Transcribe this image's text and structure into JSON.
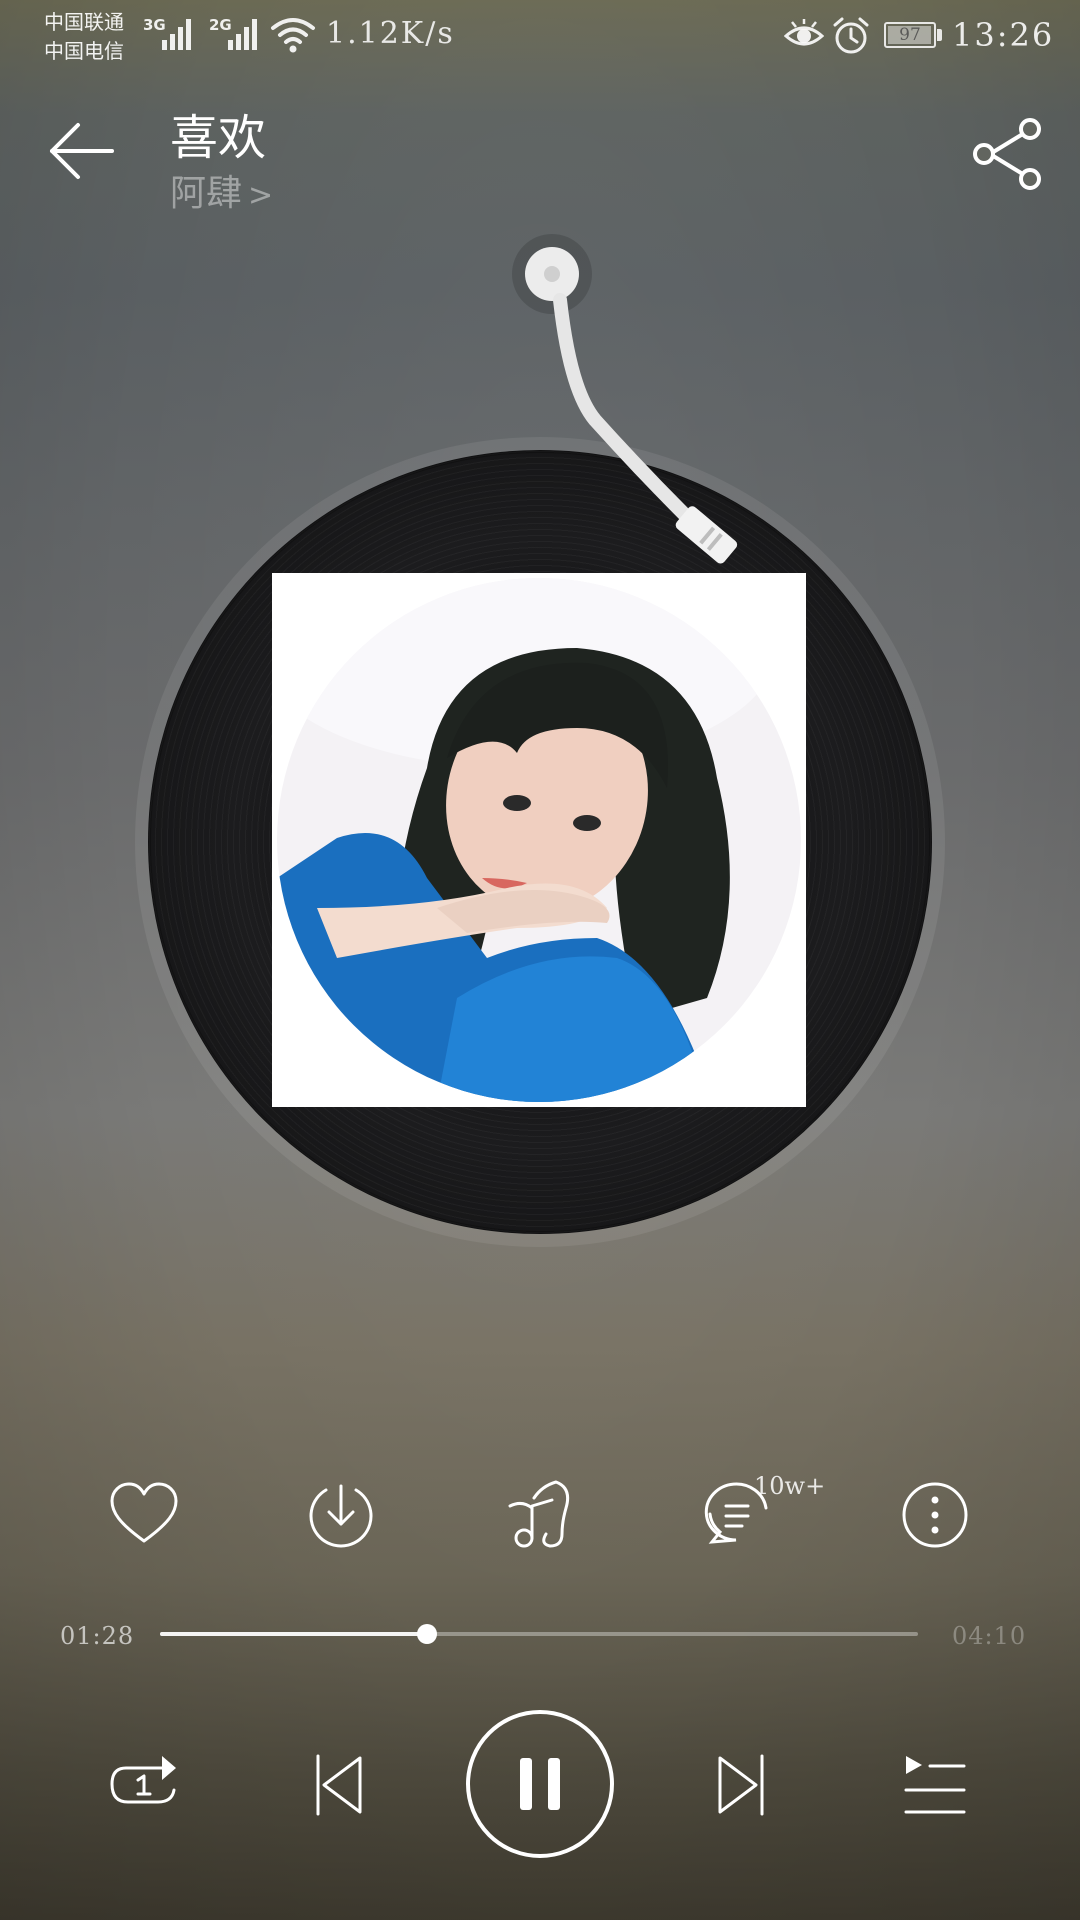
{
  "status_bar": {
    "carrier_1": "中国联通",
    "carrier_2": "中国电信",
    "network_1": "3G",
    "network_2": "2G",
    "net_speed": "1.12K/s",
    "battery": "97",
    "battery_level": 0.97,
    "time": "13:26",
    "icons": [
      "signal-icon",
      "signal-icon",
      "wifi-icon",
      "eye-icon",
      "alarm-icon",
      "battery-icon"
    ]
  },
  "header": {
    "song_title": "喜欢",
    "artist": "阿肆",
    "back_icon": "arrow-left-icon",
    "share_icon": "share-icon"
  },
  "actions": {
    "like_icon": "heart-icon",
    "download_icon": "download-icon",
    "sound_effect_icon": "music-note-icon",
    "comment_icon": "comment-icon",
    "comment_count": "10w+",
    "more_icon": "more-vertical-icon"
  },
  "progress": {
    "current_time": "01:28",
    "total_time": "04:10",
    "fraction": 0.352
  },
  "controls": {
    "repeat_icon": "repeat-one-icon",
    "prev_icon": "skip-previous-icon",
    "play_pause_icon": "pause-icon",
    "next_icon": "skip-next-icon",
    "playlist_icon": "playlist-icon"
  },
  "colors": {
    "foreground": "#ffffff",
    "disc": "#141415"
  }
}
